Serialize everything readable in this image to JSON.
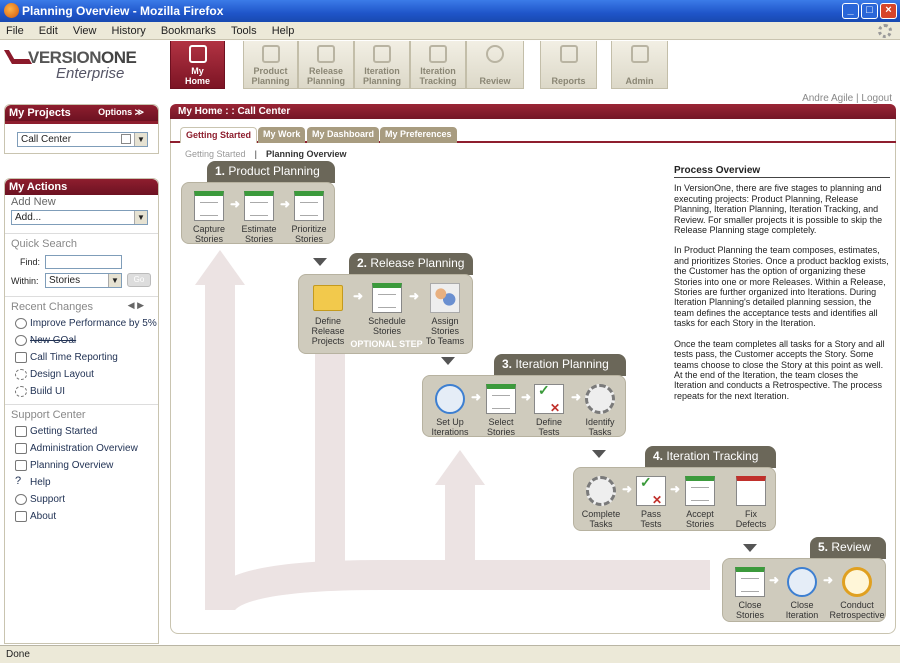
{
  "window": {
    "title": "Planning Overview - Mozilla Firefox",
    "status": "Done"
  },
  "menu": [
    "File",
    "Edit",
    "View",
    "History",
    "Bookmarks",
    "Tools",
    "Help"
  ],
  "logo": {
    "brand_a": "VERSION",
    "brand_b": "ONE",
    "edition": "Enterprise"
  },
  "nav_tabs": [
    {
      "label1": "My",
      "label2": "Home",
      "active": true
    },
    {
      "label1": "Product",
      "label2": "Planning"
    },
    {
      "label1": "Release",
      "label2": "Planning"
    },
    {
      "label1": "Iteration",
      "label2": "Planning"
    },
    {
      "label1": "Iteration",
      "label2": "Tracking"
    },
    {
      "label1": "",
      "label2": "Review"
    },
    {
      "label1": "",
      "label2": "Reports"
    },
    {
      "label1": "",
      "label2": "Admin"
    }
  ],
  "user": {
    "name": "Andre Agile",
    "sep": "|",
    "logout": "Logout"
  },
  "my_projects": {
    "title": "My Projects",
    "options": "Options ≫",
    "selected": "Call Center"
  },
  "my_actions": {
    "title": "My Actions",
    "add_new": "Add New",
    "add_select": "Add...",
    "quick_search": "Quick Search",
    "find_label": "Find:",
    "find_value": "",
    "within_label": "Within:",
    "within_value": "Stories",
    "go": "Go",
    "recent_changes": "Recent Changes",
    "recent": [
      "Improve Performance by 5%",
      "New GOal",
      "Call Time Reporting",
      "Design Layout",
      "Build UI"
    ],
    "support_center": "Support Center",
    "support": [
      "Getting Started",
      "Administration Overview",
      "Planning Overview",
      "Help",
      "Support",
      "About"
    ]
  },
  "main": {
    "title": "My Home : : Call Center",
    "subtabs": [
      "Getting Started",
      "My Work",
      "My Dashboard",
      "My Preferences"
    ],
    "crumb_a": "Getting Started",
    "crumb_sep": "|",
    "crumb_b": "Planning Overview"
  },
  "stages": [
    {
      "num": "1.",
      "name": "Product Planning",
      "steps": [
        [
          "Capture",
          "Stories"
        ],
        [
          "Estimate",
          "Stories"
        ],
        [
          "Prioritize",
          "Stories"
        ]
      ]
    },
    {
      "num": "2.",
      "name": "Release Planning",
      "steps": [
        [
          "Define Release",
          "Projects"
        ],
        [
          "Schedule",
          "Stories"
        ],
        [
          "Assign Stories",
          "To Teams"
        ]
      ],
      "note": "OPTIONAL STEP"
    },
    {
      "num": "3.",
      "name": "Iteration Planning",
      "steps": [
        [
          "Set Up",
          "Iterations"
        ],
        [
          "Select",
          "Stories"
        ],
        [
          "Define",
          "Tests"
        ],
        [
          "Identify",
          "Tasks"
        ]
      ]
    },
    {
      "num": "4.",
      "name": "Iteration Tracking",
      "steps": [
        [
          "Complete",
          "Tasks"
        ],
        [
          "Pass",
          "Tests"
        ],
        [
          "Accept",
          "Stories"
        ],
        [
          "Fix",
          "Defects"
        ]
      ]
    },
    {
      "num": "5.",
      "name": "Review",
      "steps": [
        [
          "Close",
          "Stories"
        ],
        [
          "Close",
          "Iteration"
        ],
        [
          "Conduct",
          "Retrospective"
        ]
      ]
    }
  ],
  "overview": {
    "title": "Process Overview",
    "p1": "In VersionOne, there are five stages to planning and executing projects: Product Planning, Release Planning, Iteration Planning, Iteration Tracking, and Review. For smaller projects it is possible to skip the Release Planning stage completely.",
    "p2": "In Product Planning the team composes, estimates, and prioritizes Stories. Once a product backlog exists, the Customer has the option of organizing these Stories into one or more Releases. Within a Release, Stories are further organized into Iterations. During Iteration Planning's detailed planning session, the team defines the acceptance tests and identifies all tasks for each Story in the Iteration.",
    "p3": "Once the team completes all tasks for a Story and all tests pass, the Customer accepts the Story. Some teams choose to close the Story at this point as well. At the end of the Iteration, the team closes the Iteration and conducts a Retrospective. The process repeats for the next Iteration."
  }
}
